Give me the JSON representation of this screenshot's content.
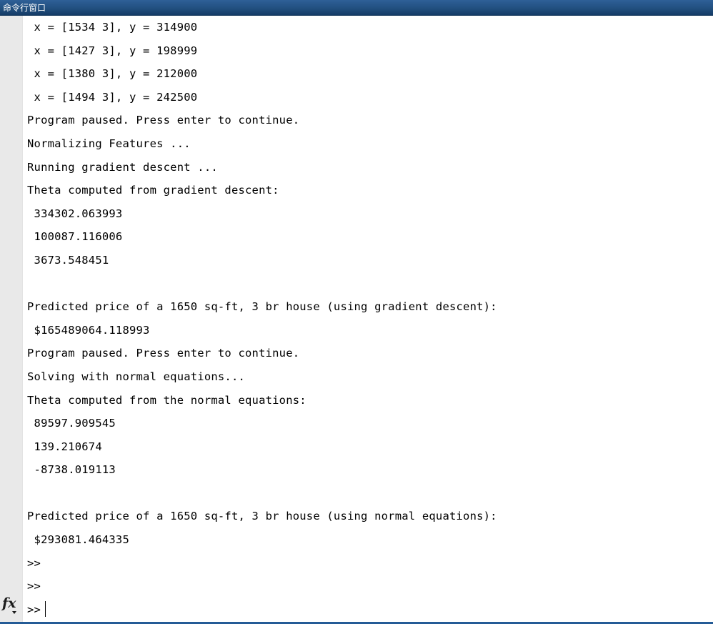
{
  "window": {
    "title": "命令行窗口",
    "title_bar_color_top": "#2f6097",
    "title_bar_color_bottom": "#123a66",
    "bottom_border_color": "#245b96",
    "gutter_color": "#e9e9e9",
    "background_color": "#ffffff",
    "text_color": "#000000"
  },
  "prompt_icon": {
    "name": "fx",
    "label": "fx",
    "tooltip": "Insert Function"
  },
  "console": {
    "lines": [
      " x = [1534 3], y = 314900",
      " x = [1427 3], y = 198999",
      " x = [1380 3], y = 212000",
      " x = [1494 3], y = 242500",
      "Program paused. Press enter to continue.",
      "Normalizing Features ...",
      "Running gradient descent ...",
      "Theta computed from gradient descent:",
      " 334302.063993",
      " 100087.116006",
      " 3673.548451",
      "",
      "Predicted price of a 1650 sq-ft, 3 br house (using gradient descent):",
      " $165489064.118993",
      "Program paused. Press enter to continue.",
      "Solving with normal equations...",
      "Theta computed from the normal equations:",
      " 89597.909545",
      " 139.210674",
      " -8738.019113",
      "",
      "Predicted price of a 1650 sq-ft, 3 br house (using normal equations):",
      " $293081.464335",
      ">>",
      ">>"
    ],
    "active_prompt": ">>",
    "input_value": ""
  }
}
